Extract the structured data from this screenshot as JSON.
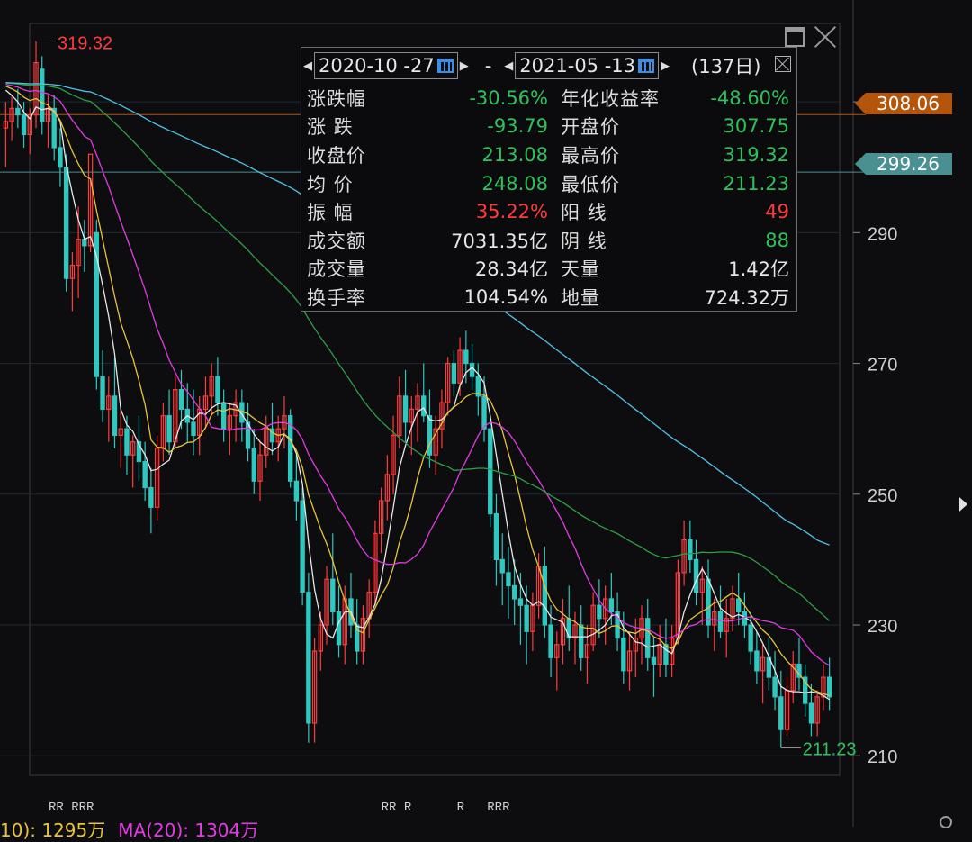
{
  "chart_data": {
    "type": "candlestick",
    "ylim": [
      207,
      322
    ],
    "y_ticks": [
      210,
      230,
      250,
      270,
      290,
      310
    ],
    "range_high_label": "319.32",
    "range_low_label": "211.23",
    "price_tags": [
      {
        "value": "308.06",
        "price": 308.06,
        "color": "#b5550b"
      },
      {
        "value": "299.26",
        "price": 299.26,
        "color": "#4a8f92"
      }
    ],
    "marker_rows": "RR RRR                                      RR R      R   RRR                                                                       R   RRRRRRRR            R    R",
    "ma_legend": {
      "ma10": "10): 1295万",
      "ma20": "MA(20): 1304万"
    },
    "candles": [
      [
        306,
        310,
        300,
        307
      ],
      [
        307,
        311,
        304,
        309
      ],
      [
        309,
        312,
        306,
        308
      ],
      [
        308,
        310,
        303,
        305
      ],
      [
        305,
        309,
        302,
        308
      ],
      [
        308,
        319.32,
        306,
        316
      ],
      [
        315,
        317,
        305,
        307
      ],
      [
        307,
        311,
        303,
        309
      ],
      [
        309,
        311,
        301,
        303
      ],
      [
        303,
        306,
        297,
        300
      ],
      [
        300,
        302,
        281,
        283
      ],
      [
        283,
        287,
        278,
        285
      ],
      [
        285,
        294,
        280,
        289
      ],
      [
        289,
        292,
        284,
        288
      ],
      [
        288,
        298,
        287,
        302
      ],
      [
        290,
        292,
        266,
        268
      ],
      [
        268,
        272,
        261,
        263
      ],
      [
        263,
        268,
        258,
        265
      ],
      [
        265,
        271,
        257,
        259
      ],
      [
        259,
        263,
        254,
        260
      ],
      [
        260,
        262,
        253,
        256
      ],
      [
        256,
        259,
        251,
        258
      ],
      [
        258,
        262,
        252,
        255
      ],
      [
        255,
        258,
        249,
        251
      ],
      [
        251,
        254,
        244,
        248
      ],
      [
        248,
        259,
        246,
        257
      ],
      [
        257,
        264,
        255,
        262
      ],
      [
        262,
        266,
        256,
        258
      ],
      [
        258,
        268,
        257,
        266
      ],
      [
        266,
        269,
        260,
        263
      ],
      [
        263,
        267,
        258,
        261
      ],
      [
        261,
        266,
        256,
        259
      ],
      [
        259,
        265,
        256,
        263
      ],
      [
        263,
        268,
        260,
        265
      ],
      [
        265,
        270,
        262,
        268
      ],
      [
        268,
        271,
        262,
        264
      ],
      [
        264,
        266,
        258,
        260
      ],
      [
        260,
        264,
        256,
        262
      ],
      [
        262,
        266,
        258,
        264
      ],
      [
        264,
        266,
        258,
        261
      ],
      [
        261,
        264,
        255,
        257
      ],
      [
        257,
        260,
        250,
        252
      ],
      [
        252,
        258,
        249,
        256
      ],
      [
        256,
        262,
        254,
        260
      ],
      [
        260,
        264,
        256,
        258
      ],
      [
        258,
        262,
        255,
        260
      ],
      [
        260,
        265,
        257,
        262
      ],
      [
        262,
        263,
        251,
        252
      ],
      [
        252,
        256,
        246,
        249
      ],
      [
        249,
        251,
        233,
        235
      ],
      [
        235,
        238,
        212,
        215
      ],
      [
        215,
        228,
        212,
        226
      ],
      [
        226,
        232,
        223,
        230
      ],
      [
        230,
        239,
        227,
        237
      ],
      [
        237,
        244,
        230,
        232
      ],
      [
        232,
        236,
        225,
        227
      ],
      [
        227,
        236,
        224,
        234
      ],
      [
        234,
        238,
        228,
        230
      ],
      [
        230,
        234,
        224,
        226
      ],
      [
        226,
        233,
        224,
        231
      ],
      [
        231,
        237,
        228,
        235
      ],
      [
        235,
        246,
        233,
        244
      ],
      [
        244,
        251,
        241,
        249
      ],
      [
        249,
        256,
        246,
        253
      ],
      [
        253,
        262,
        250,
        259
      ],
      [
        259,
        268,
        257,
        265
      ],
      [
        265,
        269,
        258,
        261
      ],
      [
        261,
        265,
        256,
        263
      ],
      [
        263,
        267,
        258,
        265
      ],
      [
        265,
        270,
        261,
        262
      ],
      [
        262,
        266,
        254,
        256
      ],
      [
        256,
        262,
        253,
        260
      ],
      [
        260,
        266,
        257,
        264
      ],
      [
        264,
        271,
        262,
        270
      ],
      [
        270,
        272,
        265,
        267
      ],
      [
        267,
        274,
        265,
        272
      ],
      [
        272,
        275,
        267,
        270
      ],
      [
        270,
        273,
        266,
        268
      ],
      [
        268,
        270,
        262,
        265
      ],
      [
        265,
        268,
        258,
        260
      ],
      [
        260,
        262,
        245,
        247
      ],
      [
        247,
        250,
        236,
        240
      ],
      [
        240,
        244,
        233,
        238
      ],
      [
        238,
        242,
        231,
        236
      ],
      [
        236,
        240,
        230,
        234
      ],
      [
        234,
        238,
        227,
        233
      ],
      [
        233,
        236,
        224,
        229
      ],
      [
        229,
        235,
        226,
        233
      ],
      [
        233,
        241,
        231,
        239
      ],
      [
        239,
        242,
        228,
        230
      ],
      [
        230,
        233,
        222,
        225
      ],
      [
        225,
        229,
        220,
        227
      ],
      [
        227,
        234,
        224,
        231
      ],
      [
        231,
        236,
        226,
        228
      ],
      [
        228,
        232,
        224,
        230
      ],
      [
        230,
        233,
        223,
        225
      ],
      [
        225,
        230,
        221,
        227
      ],
      [
        227,
        235,
        226,
        233
      ],
      [
        233,
        237,
        228,
        231
      ],
      [
        231,
        236,
        227,
        234
      ],
      [
        234,
        238,
        230,
        232
      ],
      [
        232,
        235,
        226,
        228
      ],
      [
        228,
        232,
        221,
        223
      ],
      [
        223,
        229,
        220,
        226
      ],
      [
        226,
        231,
        222,
        228
      ],
      [
        228,
        233,
        224,
        231
      ],
      [
        231,
        234,
        223,
        225
      ],
      [
        225,
        228,
        219,
        224
      ],
      [
        224,
        230,
        222,
        227
      ],
      [
        227,
        231,
        222,
        224
      ],
      [
        224,
        230,
        222,
        228
      ],
      [
        228,
        240,
        227,
        238
      ],
      [
        238,
        246,
        236,
        243
      ],
      [
        243,
        246,
        238,
        240
      ],
      [
        240,
        243,
        233,
        235
      ],
      [
        235,
        239,
        230,
        237
      ],
      [
        237,
        240,
        228,
        230
      ],
      [
        230,
        234,
        226,
        232
      ],
      [
        232,
        236,
        228,
        229
      ],
      [
        229,
        234,
        225,
        231
      ],
      [
        231,
        236,
        229,
        234
      ],
      [
        234,
        238,
        230,
        232
      ],
      [
        232,
        235,
        228,
        230
      ],
      [
        230,
        232,
        224,
        226
      ],
      [
        226,
        229,
        221,
        223
      ],
      [
        223,
        227,
        218,
        225
      ],
      [
        225,
        228,
        220,
        222
      ],
      [
        222,
        226,
        217,
        219
      ],
      [
        219,
        223,
        211.23,
        214
      ],
      [
        214,
        222,
        213,
        220
      ],
      [
        220,
        226,
        218,
        224
      ],
      [
        224,
        228,
        220,
        222
      ],
      [
        222,
        224,
        216,
        218
      ],
      [
        218,
        221,
        213,
        215
      ],
      [
        215,
        220,
        213,
        219
      ],
      [
        219,
        224,
        217,
        222
      ],
      [
        222,
        225,
        217,
        219
      ]
    ]
  },
  "stats": {
    "date_start": "2020-10 -27",
    "date_separator": "-",
    "date_end": "2021-05 -13",
    "days": "(137日)",
    "rows": [
      {
        "l1": "涨跌幅",
        "v1": "-30.56%",
        "c1": "down",
        "l2": "年化收益率",
        "v2": "-48.60%",
        "c2": "down"
      },
      {
        "l1": "涨  跌",
        "v1": "-93.79",
        "c1": "down",
        "l2": "开盘价",
        "v2": "307.75",
        "c2": "down"
      },
      {
        "l1": "收盘价",
        "v1": "213.08",
        "c1": "down",
        "l2": "最高价",
        "v2": "319.32",
        "c2": "down"
      },
      {
        "l1": "均  价",
        "v1": "248.08",
        "c1": "down",
        "l2": "最低价",
        "v2": "211.23",
        "c2": "down"
      },
      {
        "l1": "振  幅",
        "v1": "35.22%",
        "c1": "up",
        "l2": "阳  线",
        "v2": "49",
        "c2": "up"
      },
      {
        "l1": "成交额",
        "v1": "7031.35亿",
        "c1": "neutral",
        "l2": "阴  线",
        "v2": "88",
        "c2": "down"
      },
      {
        "l1": "成交量",
        "v1": "28.34亿",
        "c1": "neutral",
        "l2": "天量",
        "v2": "1.42亿",
        "c2": "neutral"
      },
      {
        "l1": "换手率",
        "v1": "104.54%",
        "c1": "neutral",
        "l2": "地量",
        "v2": "724.32万",
        "c2": "neutral"
      }
    ]
  },
  "colors": {
    "up": "#ff3b3b",
    "down": "#2fc8c0",
    "ma5": "#e8e8e8",
    "ma10": "#e8c43a",
    "ma20": "#e23be3",
    "ma60": "#2ea043",
    "ma120": "#4fc3e6",
    "grid": "#1e2a33"
  }
}
